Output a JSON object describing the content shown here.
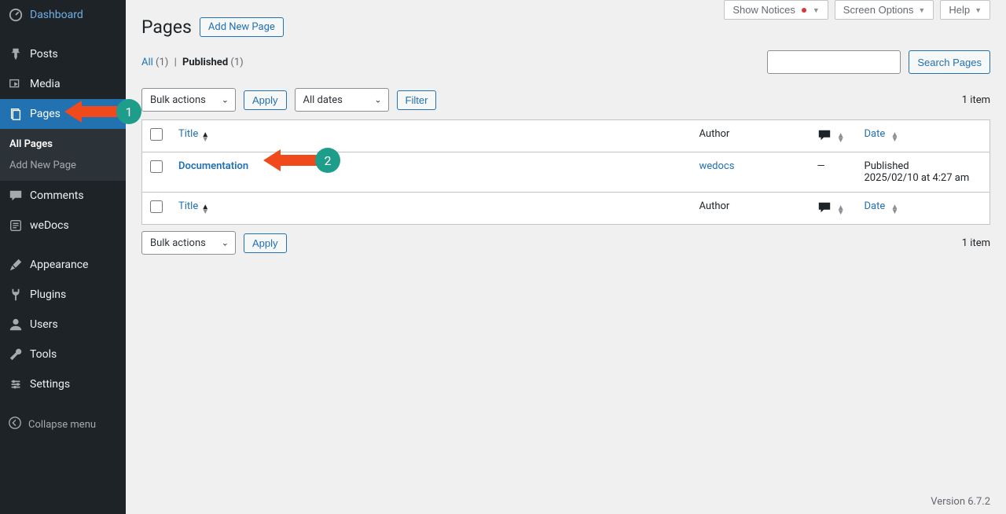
{
  "sidebar": {
    "items": [
      {
        "id": "dashboard",
        "label": "Dashboard",
        "icon": "dashboard"
      },
      {
        "id": "posts",
        "label": "Posts",
        "icon": "pin"
      },
      {
        "id": "media",
        "label": "Media",
        "icon": "media"
      },
      {
        "id": "pages",
        "label": "Pages",
        "icon": "pages",
        "active": true
      },
      {
        "id": "comments",
        "label": "Comments",
        "icon": "comment"
      },
      {
        "id": "wedocs",
        "label": "weDocs",
        "icon": "wedocs"
      },
      {
        "id": "appearance",
        "label": "Appearance",
        "icon": "brush"
      },
      {
        "id": "plugins",
        "label": "Plugins",
        "icon": "plug"
      },
      {
        "id": "users",
        "label": "Users",
        "icon": "user"
      },
      {
        "id": "tools",
        "label": "Tools",
        "icon": "wrench"
      },
      {
        "id": "settings",
        "label": "Settings",
        "icon": "settings"
      }
    ],
    "submenu": {
      "parent": "pages",
      "items": [
        {
          "label": "All Pages",
          "current": true
        },
        {
          "label": "Add New Page",
          "current": false
        }
      ]
    },
    "collapse_label": "Collapse menu"
  },
  "topbar": {
    "show_notices": "Show Notices",
    "screen_options": "Screen Options",
    "help": "Help"
  },
  "heading": {
    "title": "Pages",
    "add_new": "Add New Page"
  },
  "views": {
    "all_label": "All",
    "all_count": "(1)",
    "published_label": "Published",
    "published_count": "(1)"
  },
  "search": {
    "button": "Search Pages"
  },
  "tablenav": {
    "bulk_label": "Bulk actions",
    "apply": "Apply",
    "dates_label": "All dates",
    "filter": "Filter",
    "items_count": "1 item"
  },
  "table": {
    "columns": {
      "title": "Title",
      "author": "Author",
      "date": "Date"
    },
    "rows": [
      {
        "title": "Documentation",
        "author": "wedocs",
        "comments": "—",
        "date_status": "Published",
        "date_value": "2025/02/10 at 4:27 am"
      }
    ]
  },
  "footer": {
    "version": "Version 6.7.2"
  },
  "annotations": {
    "a1": "1",
    "a2": "2"
  }
}
